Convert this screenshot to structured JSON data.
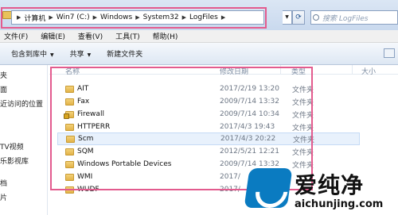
{
  "address": {
    "crumbs": [
      "计算机",
      "Win7 (C:)",
      "Windows",
      "System32",
      "LogFiles"
    ],
    "search_placeholder": "搜索 LogFiles"
  },
  "menu": [
    "文件(F)",
    "编辑(E)",
    "查看(V)",
    "工具(T)",
    "帮助(H)"
  ],
  "toolbar": {
    "include_library": "包含到库中",
    "share": "共享",
    "new_folder": "新建文件夹"
  },
  "nav": {
    "items": [
      "夹",
      "面",
      "近访问的位置",
      "TV视频",
      "乐影视库",
      "档",
      "片"
    ]
  },
  "columns": {
    "name": "名称",
    "date": "修改日期",
    "type": "类型",
    "size": "大小"
  },
  "files": [
    {
      "name": "AIT",
      "date": "2017/2/19 13:20",
      "type": "文件夹"
    },
    {
      "name": "Fax",
      "date": "2009/7/14 13:32",
      "type": "文件夹"
    },
    {
      "name": "Firewall",
      "date": "2009/7/14 10:34",
      "type": "文件夹"
    },
    {
      "name": "HTTPERR",
      "date": "2017/4/3 19:43",
      "type": "文件夹"
    },
    {
      "name": "Scm",
      "date": "2017/4/3 20:22",
      "type": "文件夹"
    },
    {
      "name": "SQM",
      "date": "2012/5/21 12:21",
      "type": "文件夹"
    },
    {
      "name": "Windows Portable Devices",
      "date": "2009/7/14 13:32",
      "type": "文件夹"
    },
    {
      "name": "WMI",
      "date": "2017/",
      "type": ""
    },
    {
      "name": "WUDF",
      "date": "2017/",
      "type": ""
    }
  ],
  "watermark": {
    "text": "爱纯净",
    "url": "aichunjing.com"
  },
  "colors": {
    "highlight": "#e35b8e",
    "selected_row": "#e8f1fc"
  }
}
